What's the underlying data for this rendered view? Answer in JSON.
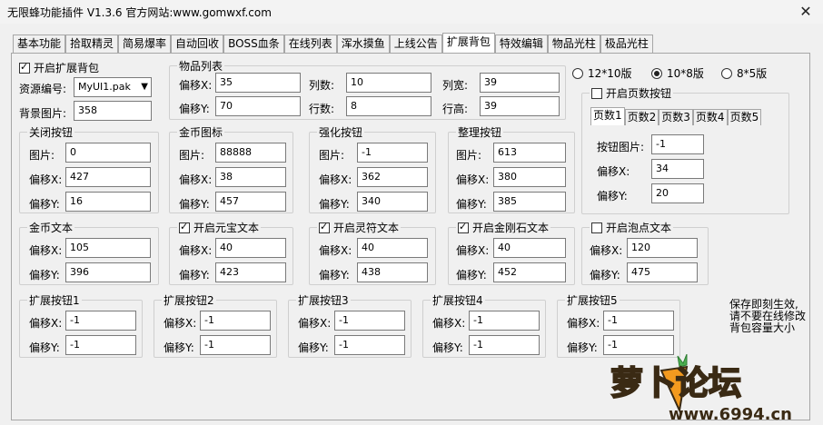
{
  "window": {
    "title": "无限蜂功能插件 V1.3.6  官方网站:www.gomwxf.com",
    "close": "✕"
  },
  "tabs": [
    "基本功能",
    "拾取精灵",
    "简易爆率",
    "自动回收",
    "BOSS血条",
    "在线列表",
    "浑水摸鱼",
    "上线公告",
    "扩展背包",
    "特效编辑",
    "物品光柱",
    "极品光柱"
  ],
  "active_tab": "扩展背包",
  "left": {
    "enable_label": "开启扩展背包",
    "enable_checked": true,
    "resource_label": "资源编号:",
    "resource_value": "MyUI1.pak",
    "bg_label": "背景图片:",
    "bg_value": "358"
  },
  "items_list": {
    "title": "物品列表",
    "offset_x_label": "偏移X:",
    "offset_x": "35",
    "offset_y_label": "偏移Y:",
    "offset_y": "70",
    "cols_label": "列数:",
    "cols": "10",
    "rows_label": "行数:",
    "rows": "8",
    "col_width_label": "列宽:",
    "col_width": "39",
    "row_height_label": "行高:",
    "row_height": "39"
  },
  "layout_radios": [
    {
      "label": "12*10版",
      "checked": false
    },
    {
      "label": "10*8版",
      "checked": true
    },
    {
      "label": "8*5版",
      "checked": false
    }
  ],
  "page_button": {
    "enable_label": "开启页数按钮",
    "enable_checked": false,
    "page_tabs": [
      "页数1",
      "页数2",
      "页数3",
      "页数4",
      "页数5"
    ],
    "image_label": "按钮图片:",
    "image": "-1",
    "offset_x_label": "偏移X:",
    "offset_x": "34",
    "offset_y_label": "偏移Y:",
    "offset_y": "20"
  },
  "close_button": {
    "title": "关闭按钮",
    "image_label": "图片:",
    "image": "0",
    "x_label": "偏移X:",
    "x": "427",
    "y_label": "偏移Y:",
    "y": "16"
  },
  "gold_icon": {
    "title": "金币图标",
    "image_label": "图片:",
    "image": "88888",
    "x_label": "偏移X:",
    "x": "38",
    "y_label": "偏移Y:",
    "y": "457"
  },
  "strengthen_button": {
    "title": "强化按钮",
    "image_label": "图片:",
    "image": "-1",
    "x_label": "偏移X:",
    "x": "362",
    "y_label": "偏移Y:",
    "y": "340"
  },
  "sort_button": {
    "title": "整理按钮",
    "image_label": "图片:",
    "image": "613",
    "x_label": "偏移X:",
    "x": "380",
    "y_label": "偏移Y:",
    "y": "385"
  },
  "gold_text": {
    "title": "金币文本",
    "x_label": "偏移X:",
    "x": "105",
    "y_label": "偏移Y:",
    "y": "396"
  },
  "yuanbao_text": {
    "title": "开启元宝文本",
    "checked": true,
    "x_label": "偏移X:",
    "x": "40",
    "y_label": "偏移Y:",
    "y": "423"
  },
  "lingfu_text": {
    "title": "开启灵符文本",
    "checked": true,
    "x_label": "偏移X:",
    "x": "40",
    "y_label": "偏移Y:",
    "y": "438"
  },
  "diamond_text": {
    "title": "开启金刚石文本",
    "checked": true,
    "x_label": "偏移X:",
    "x": "40",
    "y_label": "偏移Y:",
    "y": "452"
  },
  "bubble_text": {
    "title": "开启泡点文本",
    "checked": false,
    "x_label": "偏移X:",
    "x": "120",
    "y_label": "偏移Y:",
    "y": "475"
  },
  "ext_buttons": [
    {
      "title": "扩展按钮1",
      "x_label": "偏移X:",
      "x": "-1",
      "y_label": "偏移Y:",
      "y": "-1"
    },
    {
      "title": "扩展按钮2",
      "x_label": "偏移X:",
      "x": "-1",
      "y_label": "偏移Y:",
      "y": "-1"
    },
    {
      "title": "扩展按钮3",
      "x_label": "偏移X:",
      "x": "-1",
      "y_label": "偏移Y:",
      "y": "-1"
    },
    {
      "title": "扩展按钮4",
      "x_label": "偏移X:",
      "x": "-1",
      "y_label": "偏移Y:",
      "y": "-1"
    },
    {
      "title": "扩展按钮5",
      "x_label": "偏移X:",
      "x": "-1",
      "y_label": "偏移Y:",
      "y": "-1"
    }
  ],
  "note": [
    "保存即刻生效,",
    "请不要在线修改",
    "背包容量大小"
  ],
  "watermark": {
    "text": "萝卜论坛",
    "url": "www.6994.cn"
  },
  "colors": {
    "watermark_orange": "#f39a1f",
    "watermark_dark": "#3a2a14",
    "background": "#f0f0f0"
  }
}
